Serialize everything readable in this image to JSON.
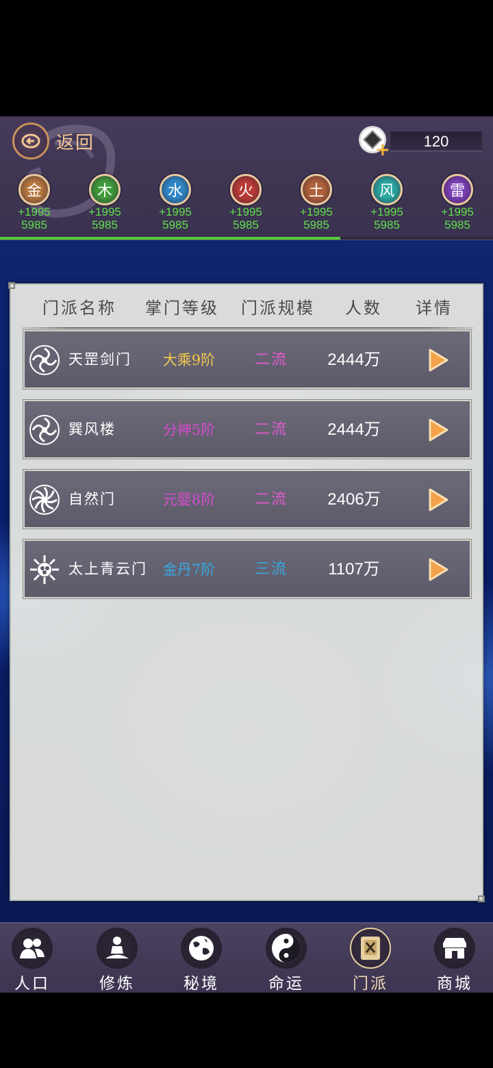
{
  "header": {
    "back_label": "返回",
    "currency_value": "120"
  },
  "elements": [
    {
      "name": "金",
      "plus": "+1995",
      "total": "5985",
      "color": "#b5763e"
    },
    {
      "name": "木",
      "plus": "+1995",
      "total": "5985",
      "color": "#3f9a3a"
    },
    {
      "name": "水",
      "plus": "+1995",
      "total": "5985",
      "color": "#2f86c6"
    },
    {
      "name": "火",
      "plus": "+1995",
      "total": "5985",
      "color": "#b83a36"
    },
    {
      "name": "土",
      "plus": "+1995",
      "total": "5985",
      "color": "#b0603a"
    },
    {
      "name": "风",
      "plus": "+1995",
      "total": "5985",
      "color": "#2aa6a0"
    },
    {
      "name": "雷",
      "plus": "+1995",
      "total": "5985",
      "color": "#7a3fb5"
    }
  ],
  "progress": 0.69,
  "table": {
    "headers": [
      "门派名称",
      "掌门等级",
      "门派规模",
      "人数",
      "详情"
    ],
    "rows": [
      {
        "name": "天罡剑门",
        "level": "大乘9阶",
        "level_color": "#f2c84b",
        "scale": "二流",
        "scale_color": "#e15ad0",
        "count": "2444万",
        "emblem": "swirl-emblem-icon"
      },
      {
        "name": "巽风楼",
        "level": "分神5阶",
        "level_color": "#d64bd0",
        "scale": "二流",
        "scale_color": "#e15ad0",
        "count": "2444万",
        "emblem": "swirl-emblem-icon"
      },
      {
        "name": "自然门",
        "level": "元婴8阶",
        "level_color": "#d64bd0",
        "scale": "二流",
        "scale_color": "#e15ad0",
        "count": "2406万",
        "emblem": "flower-emblem-icon"
      },
      {
        "name": "太上青云门",
        "level": "金丹7阶",
        "level_color": "#35a8e0",
        "scale": "三流",
        "scale_color": "#35a8e0",
        "count": "1107万",
        "emblem": "sun-emblem-icon"
      }
    ]
  },
  "nav": {
    "items": [
      {
        "label": "人口",
        "icon": "people-icon"
      },
      {
        "label": "修炼",
        "icon": "meditation-icon"
      },
      {
        "label": "秘境",
        "icon": "globe-icon"
      },
      {
        "label": "命运",
        "icon": "yin-yang-icon"
      },
      {
        "label": "门派",
        "icon": "sect-book-icon"
      },
      {
        "label": "商城",
        "icon": "shop-icon"
      }
    ],
    "active": "门派"
  }
}
